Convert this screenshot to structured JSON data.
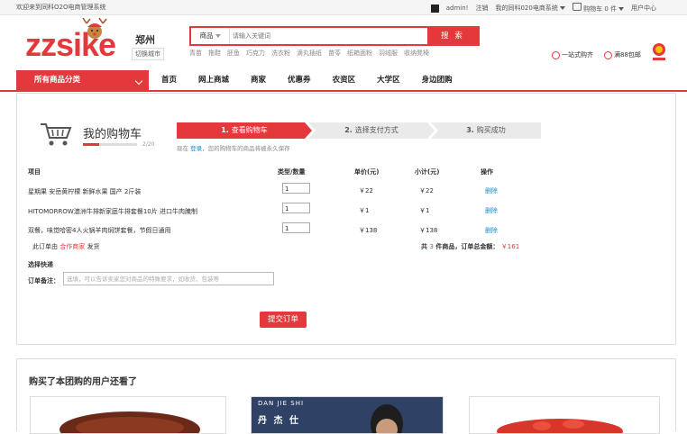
{
  "topbar": {
    "welcome": "欢迎来到同科O2O电商管理系统",
    "user": "admin!",
    "logout": "注销",
    "my_store": "我的同科020电商系统",
    "cart": "购物车",
    "cart_count": "0 件",
    "user_center": "用户中心"
  },
  "header": {
    "logo": "zzsike",
    "city": "郑州",
    "city_switch": "切换城市",
    "search_category": "商品",
    "search_placeholder": "请输入关键词",
    "search_button": "搜 索",
    "hot_words": [
      "青苗",
      "拖鞋",
      "胚鱼",
      "巧克力",
      "洗衣粉",
      "滴丸插纸",
      "苗苓",
      "纸箱面粉",
      "羽绒服",
      "收纳凳椅"
    ],
    "promo1": "一站式购齐",
    "promo2": "满88包邮"
  },
  "nav": {
    "all_categories": "所有商品分类",
    "links": [
      "首页",
      "网上商城",
      "商家",
      "优惠券",
      "农资区",
      "大学区",
      "身边团购"
    ]
  },
  "cart": {
    "title": "我的购物车",
    "progress_text": "2/20",
    "progress": 0.3,
    "steps": [
      {
        "num": "1.",
        "label": "查看购物车"
      },
      {
        "num": "2.",
        "label": "选择支付方式"
      },
      {
        "num": "3.",
        "label": "购买成功"
      }
    ],
    "saved_prefix": "现在",
    "saved_login": "登录",
    "saved_suffix": "，您的购物车的商品将被永久保存",
    "headers": {
      "item": "项目",
      "qty": "类型/数量",
      "price": "单价(元)",
      "subtotal": "小计(元)",
      "op": "操作"
    },
    "rows": [
      {
        "name": "星期果 安岳黄柠檬 新鲜水果 国产 2斤装",
        "qty": "1",
        "price": "￥22",
        "subtotal": "￥22",
        "op": "删除"
      },
      {
        "name": "HITOMORROW澳洲牛排新家庭牛排套餐10片 进口牛肉腌制",
        "qty": "1",
        "price": "￥1",
        "subtotal": "￥1",
        "op": "删除"
      },
      {
        "name": "双餐，味觉哈密4人火锅羊肉焖饼套餐，节假日通用",
        "qty": "1",
        "price": "￥138",
        "subtotal": "￥138",
        "op": "删除"
      }
    ],
    "seller_prefix": "此订单由",
    "seller_name": "合作商家",
    "seller_suffix": "发货",
    "summary_prefix": "共",
    "summary_count": "3",
    "summary_mid": "件商品，订单总金额：",
    "summary_total": "￥161",
    "shipping": "选择快递",
    "remark_label": "订单备注：",
    "remark_placeholder": "选填，可以告诉卖家您对商品的特殊要求，如收货、包装等",
    "submit": "提交订单"
  },
  "reco": {
    "title": "购买了本团购的用户还看了",
    "item2_line1": "DAN JIE SHI",
    "item2_line2": "丹 杰 仕"
  }
}
